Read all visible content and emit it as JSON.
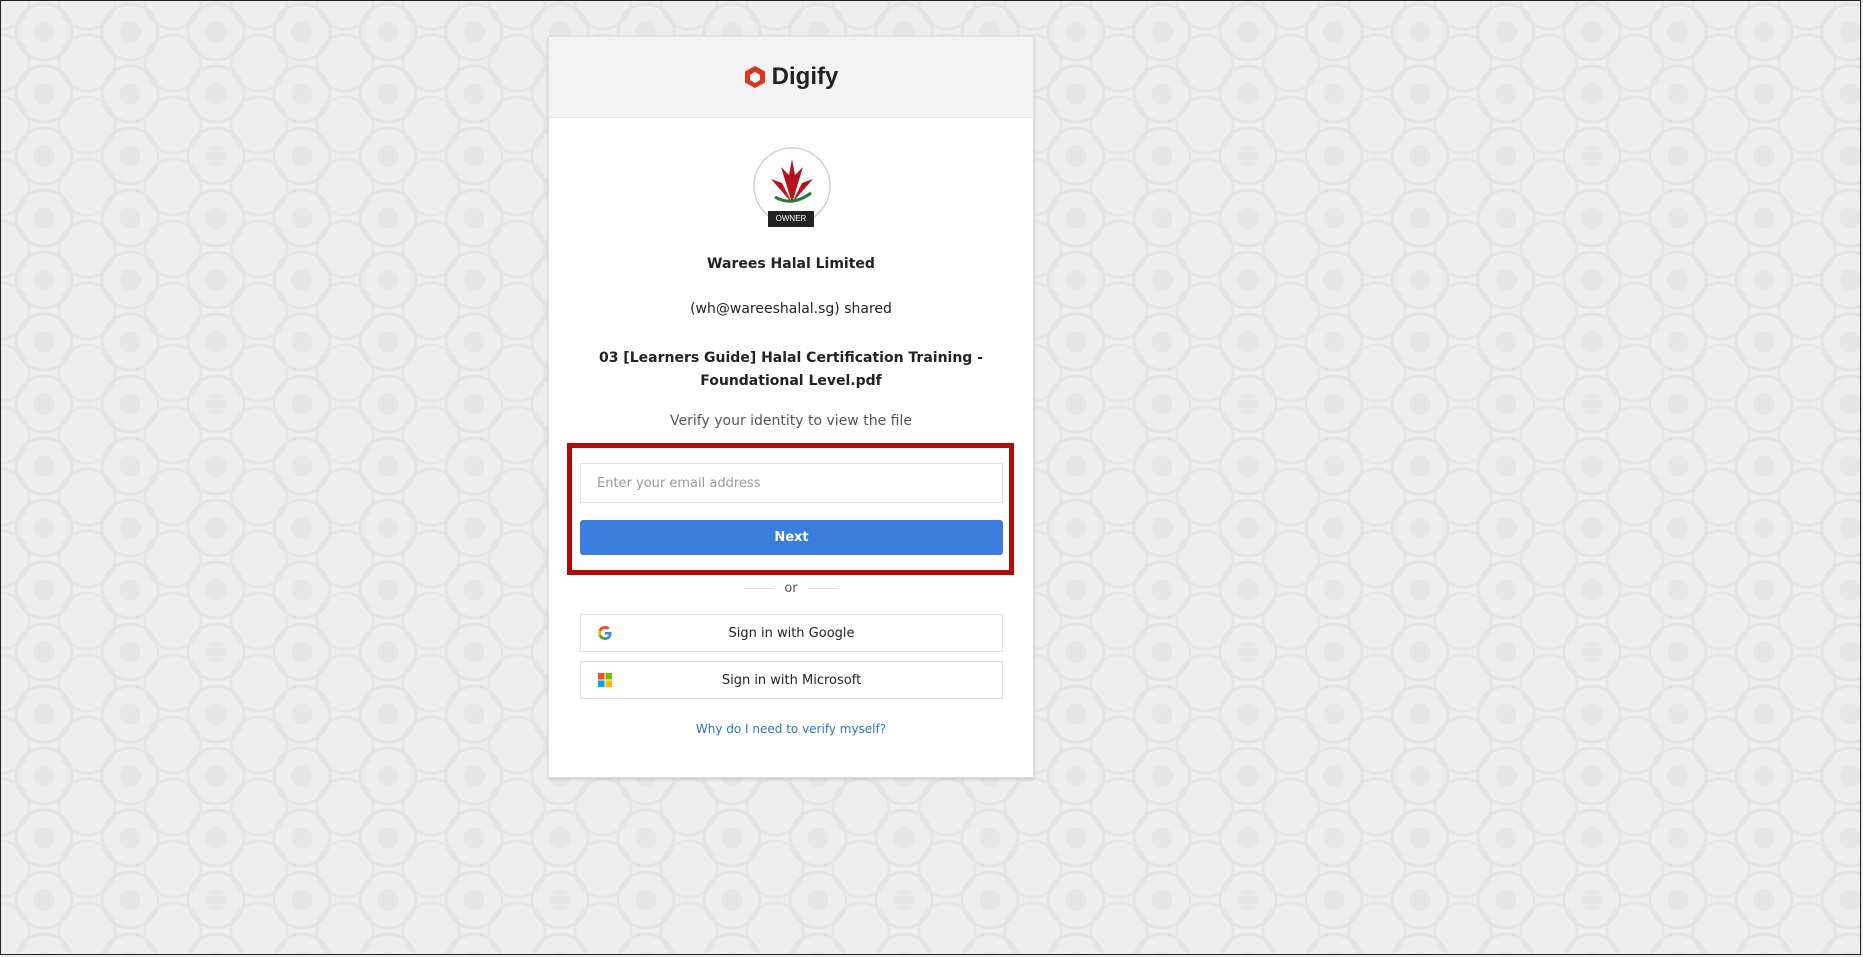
{
  "brand": {
    "name": "Digify",
    "icon": "digify-logo-icon",
    "accent": "#d9381e"
  },
  "owner": {
    "badge_label": "OWNER",
    "org_name": "Warees Halal Limited",
    "shared_text": "(wh@wareeshalal.sg) shared",
    "logo_icon": "warees-halal-logo-icon"
  },
  "file": {
    "name_line1": "03 [Learners Guide] Halal Certification Training -",
    "name_line2": "Foundational Level.pdf"
  },
  "verify": {
    "instruction": "Verify your identity to view the file",
    "email_placeholder": "Enter your email address",
    "email_value": "",
    "next_label": "Next",
    "or_label": "or",
    "google_label": "Sign in with Google",
    "microsoft_label": "Sign in with Microsoft",
    "help_link": "Why do I need to verify myself?"
  },
  "colors": {
    "primary_button": "#3b7ddd",
    "highlight_border": "#b00b0b",
    "link": "#2f6fd1"
  }
}
